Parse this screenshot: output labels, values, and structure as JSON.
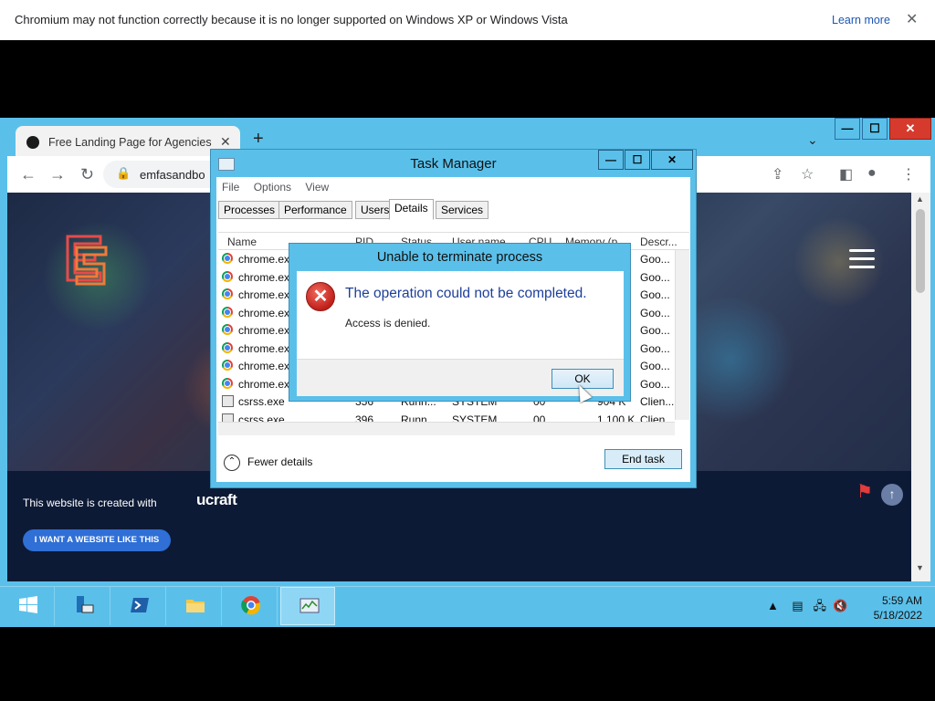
{
  "infobar": {
    "message": "Chromium may not function correctly because it is no longer supported on Windows XP or Windows Vista",
    "learn_more": "Learn more",
    "close": "✕"
  },
  "browser": {
    "tab_title": "Free Landing Page for Agencies",
    "tab_close": "✕",
    "new_tab": "+",
    "url": "emfasandbo",
    "window_buttons": {
      "minimize": "—",
      "maximize": "☐",
      "close": "✕"
    }
  },
  "website": {
    "created_with": "This website is created with",
    "brand": "ucraft",
    "cta": "I WANT A WEBSITE LIKE THIS",
    "up": "↑"
  },
  "task_manager": {
    "title": "Task Manager",
    "buttons": {
      "minimize": "—",
      "maximize": "☐",
      "close": "✕"
    },
    "menu": [
      "File",
      "Options",
      "View"
    ],
    "tabs": [
      "Processes",
      "Performance",
      "Users",
      "Details",
      "Services"
    ],
    "selected_tab": "Details",
    "columns": [
      "Name",
      "PID",
      "Status",
      "User name",
      "CPU",
      "Memory (p...",
      "Descr..."
    ],
    "rows": [
      {
        "name": "chrome.ex",
        "desc": "Goo...",
        "icon": "chrome"
      },
      {
        "name": "chrome.ex",
        "desc": "Goo...",
        "icon": "chrome"
      },
      {
        "name": "chrome.ex",
        "desc": "Goo...",
        "icon": "chrome"
      },
      {
        "name": "chrome.ex",
        "desc": "Goo...",
        "icon": "chrome"
      },
      {
        "name": "chrome.ex",
        "desc": "Goo...",
        "icon": "chrome"
      },
      {
        "name": "chrome.ex",
        "desc": "Goo...",
        "icon": "chrome"
      },
      {
        "name": "chrome.ex",
        "desc": "Goo...",
        "icon": "chrome"
      },
      {
        "name": "chrome.ex",
        "desc": "Goo...",
        "icon": "chrome"
      },
      {
        "name": "csrss.exe",
        "pid": "356",
        "status": "Runn...",
        "user": "SYSTEM",
        "cpu": "00",
        "mem": "904 K",
        "desc": "Clien...",
        "icon": "system"
      },
      {
        "name": "csrss.exe",
        "pid": "396",
        "status": "Runn...",
        "user": "SYSTEM",
        "cpu": "00",
        "mem": "1,100 K",
        "desc": "Clien...",
        "icon": "system"
      }
    ],
    "fewer_details": "Fewer details",
    "end_task": "End task"
  },
  "dialog": {
    "title": "Unable to terminate process",
    "main_instruction": "The operation could not be completed.",
    "detail": "Access is denied.",
    "ok": "OK"
  },
  "taskbar": {
    "time": "5:59 AM",
    "date": "5/18/2022",
    "apps": [
      "start",
      "server-manager",
      "powershell",
      "file-explorer",
      "chrome",
      "task-manager"
    ]
  }
}
